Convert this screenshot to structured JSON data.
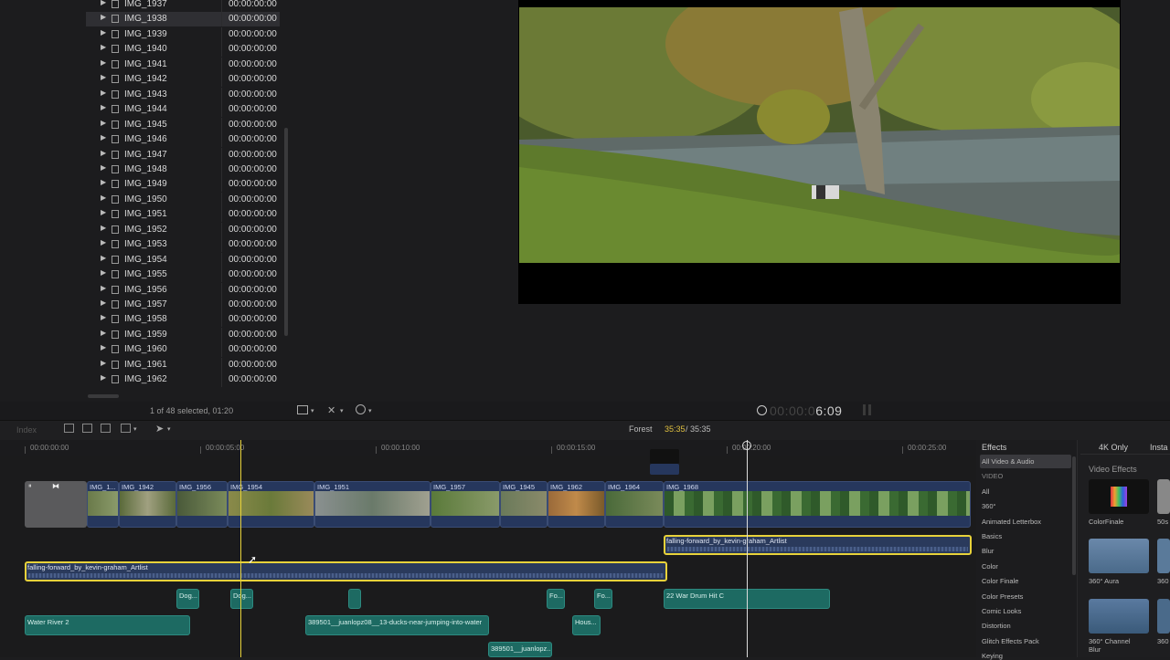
{
  "browser": {
    "rows": [
      {
        "name": "IMG_1937",
        "dur": "00:00:00:00"
      },
      {
        "name": "IMG_1938",
        "dur": "00:00:00:00",
        "selected": true
      },
      {
        "name": "IMG_1939",
        "dur": "00:00:00:00"
      },
      {
        "name": "IMG_1940",
        "dur": "00:00:00:00"
      },
      {
        "name": "IMG_1941",
        "dur": "00:00:00:00"
      },
      {
        "name": "IMG_1942",
        "dur": "00:00:00:00"
      },
      {
        "name": "IMG_1943",
        "dur": "00:00:00:00"
      },
      {
        "name": "IMG_1944",
        "dur": "00:00:00:00"
      },
      {
        "name": "IMG_1945",
        "dur": "00:00:00:00"
      },
      {
        "name": "IMG_1946",
        "dur": "00:00:00:00"
      },
      {
        "name": "IMG_1947",
        "dur": "00:00:00:00"
      },
      {
        "name": "IMG_1948",
        "dur": "00:00:00:00"
      },
      {
        "name": "IMG_1949",
        "dur": "00:00:00:00"
      },
      {
        "name": "IMG_1950",
        "dur": "00:00:00:00"
      },
      {
        "name": "IMG_1951",
        "dur": "00:00:00:00"
      },
      {
        "name": "IMG_1952",
        "dur": "00:00:00:00"
      },
      {
        "name": "IMG_1953",
        "dur": "00:00:00:00"
      },
      {
        "name": "IMG_1954",
        "dur": "00:00:00:00"
      },
      {
        "name": "IMG_1955",
        "dur": "00:00:00:00"
      },
      {
        "name": "IMG_1956",
        "dur": "00:00:00:00"
      },
      {
        "name": "IMG_1957",
        "dur": "00:00:00:00"
      },
      {
        "name": "IMG_1958",
        "dur": "00:00:00:00"
      },
      {
        "name": "IMG_1959",
        "dur": "00:00:00:00"
      },
      {
        "name": "IMG_1960",
        "dur": "00:00:00:00"
      },
      {
        "name": "IMG_1961",
        "dur": "00:00:00:00"
      },
      {
        "name": "IMG_1962",
        "dur": "00:00:00:00"
      }
    ],
    "selection_status": "1 of 48 selected, 01:20"
  },
  "viewer": {
    "timecode_dim": "00:00:0",
    "timecode_lit": "6:09"
  },
  "timeline": {
    "index_label": "Index",
    "project_name": "Forest",
    "project_position": "35:35",
    "project_duration": "/ 35:35",
    "ruler": [
      "00:00:00:00",
      "00:00:05:00",
      "00:00:10:00",
      "00:00:15:00",
      "00:00:20:00",
      "00:00:25:00"
    ],
    "video_clips": [
      "IMG_1...",
      "IMG_1942",
      "IMG_1956",
      "IMG_1954",
      "IMG_1951",
      "IMG_1957",
      "IMG_1945",
      "IMG_1962",
      "IMG_1964",
      "IMG_1968"
    ],
    "music_1": "falling-forward_by_kevin-graham_Artlist",
    "music_2": "falling-forward_by_kevin-graham_Artlist",
    "sfx": [
      "Dog...",
      "Dog...",
      "Fo...",
      "Fo...",
      "22 War Drum Hit C",
      "Water River 2",
      "389501__juanlopz08__13-ducks-near-jumping-into-water",
      "Hous...",
      "389501__juanlopz..."
    ]
  },
  "effects": {
    "header": "Effects",
    "tab_4k": "4K Only",
    "tab_insta": "Insta",
    "section": "Video Effects",
    "categories": [
      "All Video & Audio",
      "VIDEO",
      "All",
      "360°",
      "Animated Letterbox",
      "Basics",
      "Blur",
      "Color",
      "Color Finale",
      "Color Presets",
      "Comic Looks",
      "Distortion",
      "Glitch Effects Pack",
      "Keying"
    ],
    "items": [
      "ColorFinale",
      "50s",
      "360° Aura",
      "360",
      "360° Channel Blur",
      "360"
    ]
  }
}
